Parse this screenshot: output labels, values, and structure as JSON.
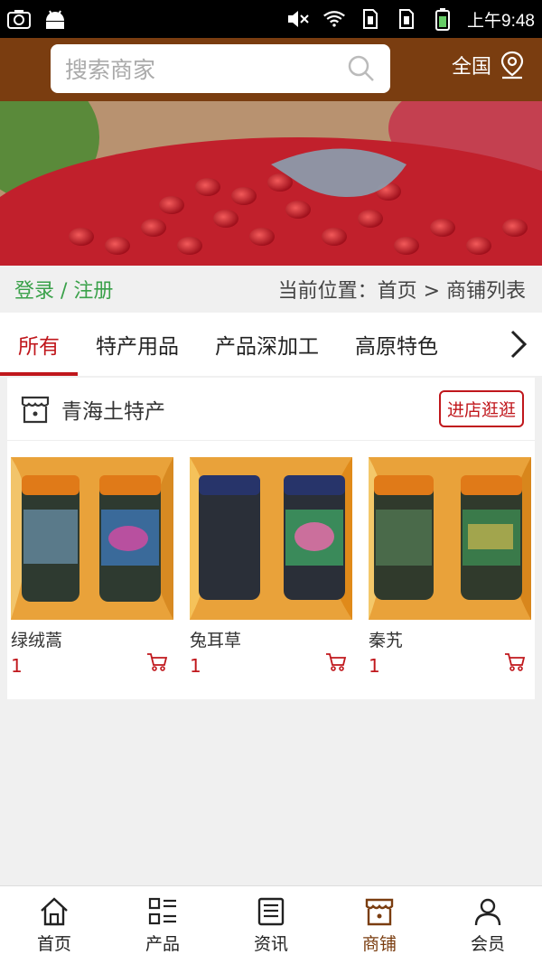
{
  "status_bar": {
    "time": "上午9:48",
    "icons": [
      "screenshot-icon",
      "android-icon",
      "mute-icon",
      "wifi-icon",
      "sim1-icon",
      "sim2-icon",
      "battery-icon"
    ]
  },
  "header": {
    "search_placeholder": "搜索商家",
    "region_label": "全国"
  },
  "breadcrumb": {
    "login_label": "登录 / 注册",
    "path": "当前位置：首页 > 商铺列表"
  },
  "tabs": [
    {
      "label": "所有",
      "active": true
    },
    {
      "label": "特产用品",
      "active": false
    },
    {
      "label": "产品深加工",
      "active": false
    },
    {
      "label": "高原特色",
      "active": false
    }
  ],
  "shop": {
    "name": "青海土特产",
    "visit_label": "进店逛逛",
    "products": [
      {
        "name": "绿绒蒿",
        "price": "1"
      },
      {
        "name": "兔耳草",
        "price": "1"
      },
      {
        "name": "秦艽",
        "price": "1"
      }
    ]
  },
  "bottom_nav": [
    {
      "label": "首页",
      "icon": "home-icon",
      "active": false
    },
    {
      "label": "产品",
      "icon": "grid-list-icon",
      "active": false
    },
    {
      "label": "资讯",
      "icon": "news-icon",
      "active": false
    },
    {
      "label": "商铺",
      "icon": "store-icon",
      "active": true
    },
    {
      "label": "会员",
      "icon": "user-icon",
      "active": false
    }
  ],
  "colors": {
    "brand": "#7a3d10",
    "accent_red": "#c0171c",
    "login_green": "#3aa14a"
  }
}
